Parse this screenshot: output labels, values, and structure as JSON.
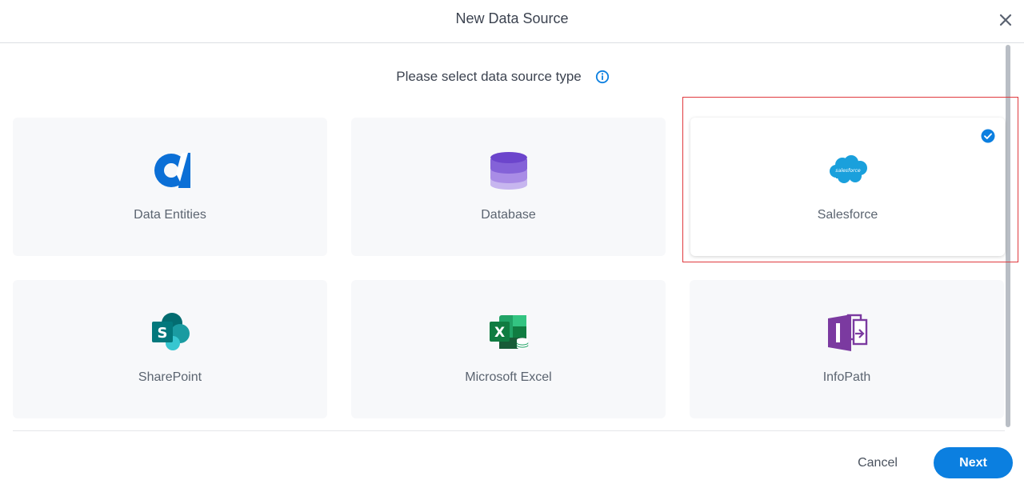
{
  "dialog": {
    "title": "New Data Source",
    "prompt": "Please select data source type",
    "close_icon": "close-icon",
    "info_icon": "info-icon"
  },
  "cards": [
    {
      "label": "Data Entities",
      "icon": "data-entities-icon",
      "selected": false
    },
    {
      "label": "Database",
      "icon": "database-icon",
      "selected": false
    },
    {
      "label": "Salesforce",
      "icon": "salesforce-icon",
      "selected": true
    },
    {
      "label": "SharePoint",
      "icon": "sharepoint-icon",
      "selected": false
    },
    {
      "label": "Microsoft Excel",
      "icon": "excel-icon",
      "selected": false
    },
    {
      "label": "InfoPath",
      "icon": "infopath-icon",
      "selected": false
    }
  ],
  "footer": {
    "cancel_label": "Cancel",
    "next_label": "Next"
  },
  "colors": {
    "accent": "#0b7fe0",
    "highlight": "#e0393e",
    "card_bg": "#f7f8fa"
  }
}
